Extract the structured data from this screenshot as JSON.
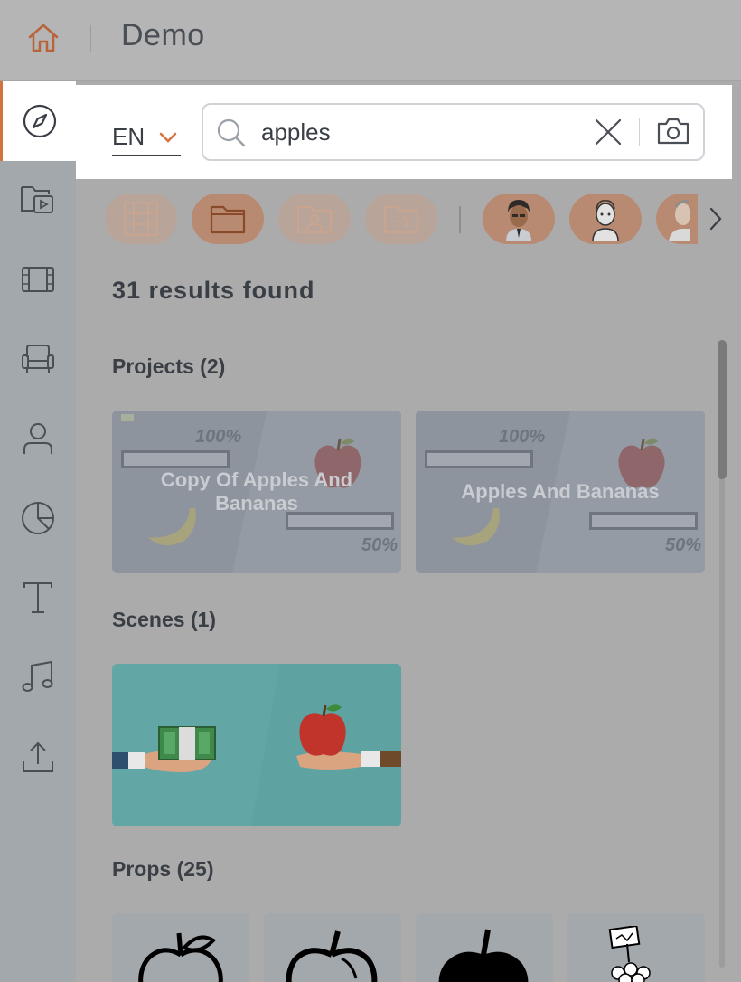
{
  "header": {
    "title": "Demo",
    "home_icon": "home-icon"
  },
  "sidebar": {
    "items": [
      {
        "name": "explore",
        "icon": "compass-icon",
        "active": true
      },
      {
        "name": "projects",
        "icon": "folder-video-icon"
      },
      {
        "name": "scenes",
        "icon": "film-icon"
      },
      {
        "name": "props",
        "icon": "armchair-icon"
      },
      {
        "name": "characters",
        "icon": "person-icon"
      },
      {
        "name": "charts",
        "icon": "pie-chart-icon"
      },
      {
        "name": "text",
        "icon": "text-icon"
      },
      {
        "name": "audio",
        "icon": "music-note-icon"
      },
      {
        "name": "upload",
        "icon": "upload-icon"
      }
    ]
  },
  "search": {
    "language": "EN",
    "query": "apples",
    "placeholder": "Search"
  },
  "filters": {
    "chips": [
      {
        "name": "scenes-filter",
        "icon": "film-strip-icon",
        "selected": false
      },
      {
        "name": "projects-filter",
        "icon": "folder-icon",
        "selected": true
      },
      {
        "name": "shared-filter",
        "icon": "folder-user-icon",
        "selected": false
      },
      {
        "name": "moved-filter",
        "icon": "folder-arrow-icon",
        "selected": false
      },
      {
        "name": "character-1",
        "icon": "character-avatar-icon",
        "selected": false
      },
      {
        "name": "character-2",
        "icon": "character-avatar-icon",
        "selected": false
      },
      {
        "name": "character-3",
        "icon": "character-avatar-icon",
        "selected": false
      }
    ]
  },
  "results": {
    "count_text": "31 results found",
    "projects": {
      "title": "Projects (2)",
      "items": [
        {
          "title": "Copy Of Apples And Bananas",
          "pct_top": "100%",
          "pct_bottom": "50%"
        },
        {
          "title": "Apples And Bananas",
          "pct_top": "100%",
          "pct_bottom": "50%"
        }
      ]
    },
    "scenes": {
      "title": "Scenes (1)"
    },
    "props": {
      "title": "Props (25)"
    }
  },
  "colors": {
    "accent": "#d2733f",
    "overlay": "#ababab",
    "text": "#3a3e45"
  }
}
